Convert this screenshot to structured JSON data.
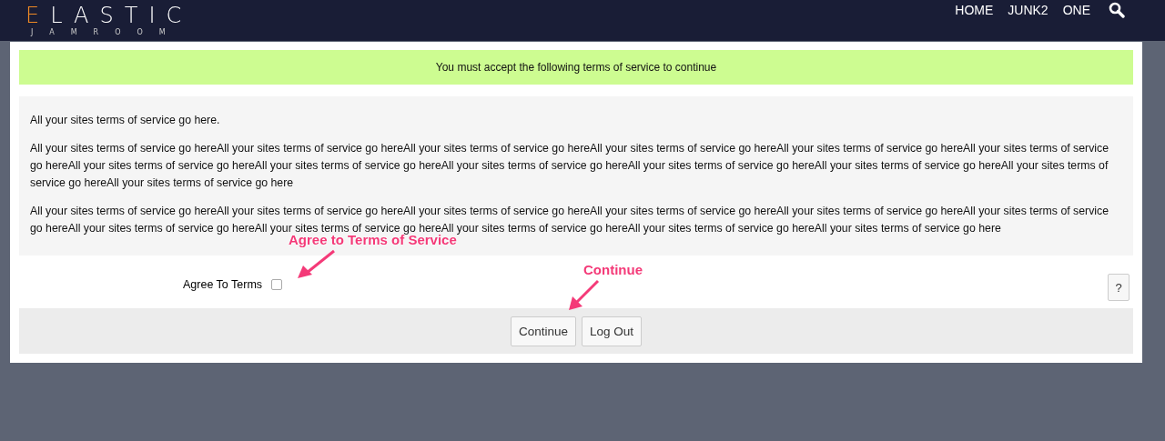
{
  "header": {
    "logo": {
      "first_letter": "E",
      "rest": "LASTIC",
      "tagline": "JAMROOM"
    },
    "nav": [
      "HOME",
      "JUNK2",
      "ONE"
    ]
  },
  "notice": "You must accept the following terms of service to continue",
  "terms": [
    "All your sites terms of service go here.",
    "All your sites terms of service go hereAll your sites terms of service go hereAll your sites terms of service go hereAll your sites terms of service go hereAll your sites terms of service go hereAll your sites terms of service go hereAll your sites terms of service go hereAll your sites terms of service go hereAll your sites terms of service go hereAll your sites terms of service go hereAll your sites terms of service go hereAll your sites terms of service go hereAll your sites terms of service go here",
    "All your sites terms of service go hereAll your sites terms of service go hereAll your sites terms of service go hereAll your sites terms of service go hereAll your sites terms of service go hereAll your sites terms of service go hereAll your sites terms of service go hereAll your sites terms of service go hereAll your sites terms of service go hereAll your sites terms of service go hereAll your sites terms of service go here"
  ],
  "agree": {
    "label": "Agree To Terms",
    "checked": false,
    "help": "?"
  },
  "buttons": [
    "Continue",
    "Log Out"
  ],
  "annotations": [
    "Agree to Terms of Service",
    "Continue"
  ]
}
